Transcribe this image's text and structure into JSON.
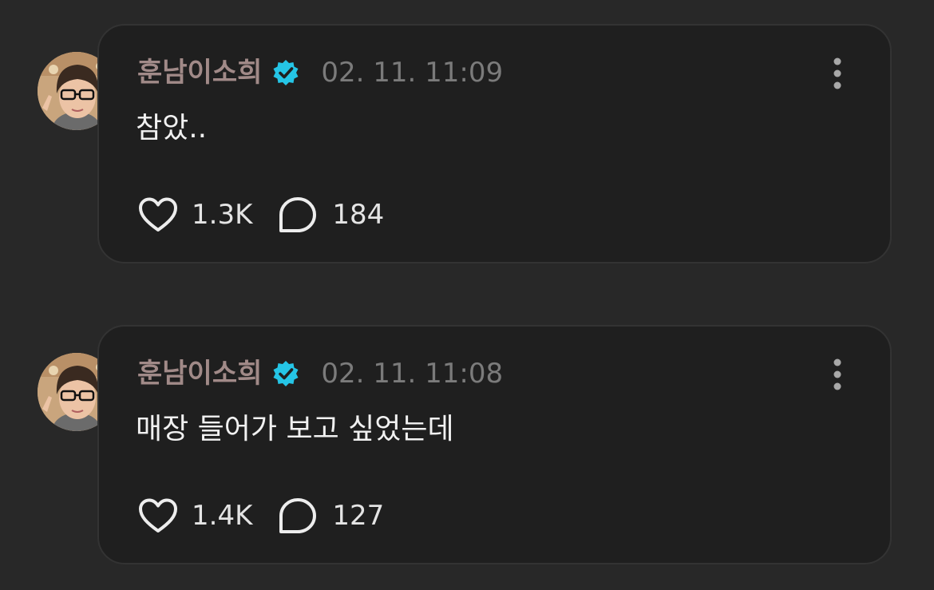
{
  "colors": {
    "background": "#282828",
    "card": "#1f1f1f",
    "card_border": "#333333",
    "username": "#a18a88",
    "verified_badge": "#25c5e6",
    "timestamp": "#7b7b7b",
    "text": "#f1f1f1"
  },
  "posts": [
    {
      "author": "훈남이소희",
      "verified_icon": "verified-badge-icon",
      "timestamp": "02. 11. 11:09",
      "text": "참았..",
      "likes": "1.3K",
      "comments": "184",
      "like_icon": "heart-icon",
      "comment_icon": "speech-bubble-icon",
      "menu_icon": "more-vertical-icon"
    },
    {
      "author": "훈남이소희",
      "verified_icon": "verified-badge-icon",
      "timestamp": "02. 11. 11:08",
      "text": "매장 들어가 보고 싶었는데",
      "likes": "1.4K",
      "comments": "127",
      "like_icon": "heart-icon",
      "comment_icon": "speech-bubble-icon",
      "menu_icon": "more-vertical-icon"
    }
  ]
}
